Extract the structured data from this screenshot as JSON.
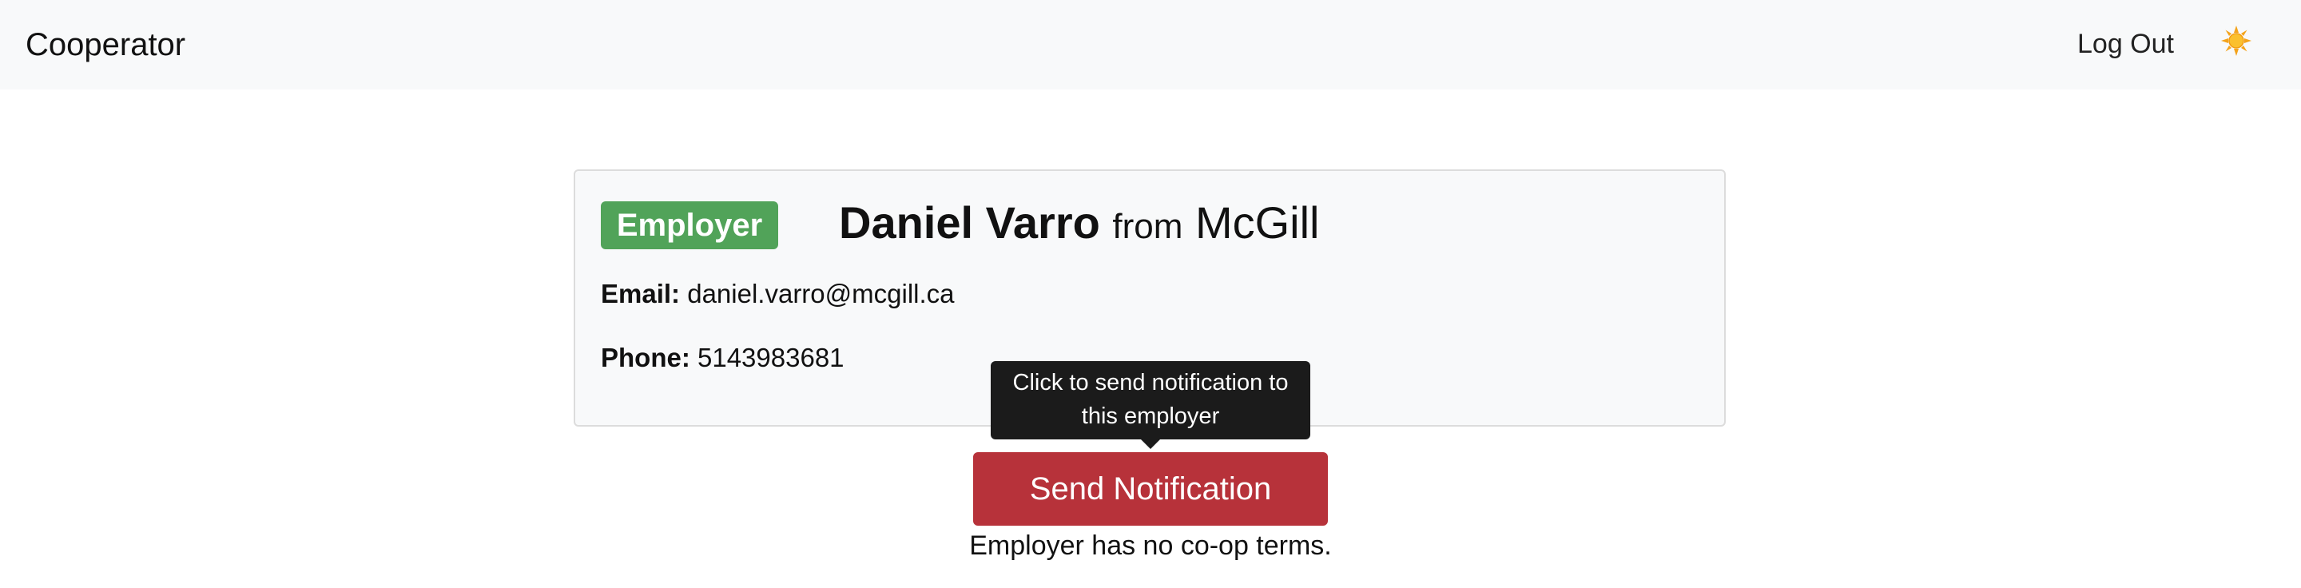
{
  "navbar": {
    "brand": "Cooperator",
    "logout_label": "Log Out",
    "theme_icon": "sun-icon"
  },
  "profile": {
    "role_badge": "Employer",
    "name": "Daniel Varro",
    "from_word": "from",
    "organization": "McGill",
    "email_label": "Email:",
    "email": "daniel.varro@mcgill.ca",
    "phone_label": "Phone:",
    "phone": "5143983681"
  },
  "actions": {
    "tooltip": "Click to send notification to this employer",
    "send_label": "Send Notification",
    "terms_status": "Employer has no co-op terms."
  },
  "colors": {
    "navbar_bg": "#f8f9fa",
    "badge_green": "#51a359",
    "danger_red": "#b7323a",
    "tooltip_bg": "#1b1b1b"
  }
}
